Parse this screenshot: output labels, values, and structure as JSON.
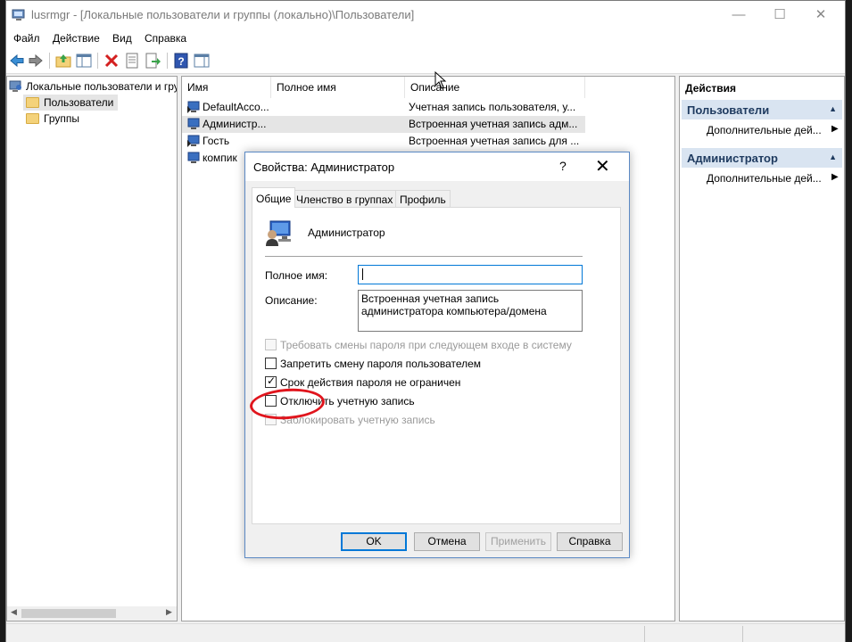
{
  "window": {
    "title": "lusrmgr - [Локальные пользователи и группы (локально)\\Пользователи]",
    "minimize": "—",
    "maximize": "☐",
    "close": "✕"
  },
  "menu": [
    "Файл",
    "Действие",
    "Вид",
    "Справка"
  ],
  "toolbar": {
    "buttons": [
      "back-icon",
      "forward-icon",
      "up-folder-icon",
      "show-hide-tree-icon",
      "delete-icon",
      "properties-icon",
      "export-icon",
      "help-icon",
      "show-action-pane-icon"
    ]
  },
  "tree": {
    "root": "Локальные пользователи и гру",
    "items": [
      "Пользователи",
      "Группы"
    ],
    "scroll_left": "◀",
    "scroll_right": "▶"
  },
  "list": {
    "columns": [
      "Имя",
      "Полное имя",
      "Описание"
    ],
    "rows": [
      {
        "name": "DefaultAcco...",
        "fullname": "",
        "description": "Учетная запись пользователя, у..."
      },
      {
        "name": "Администр...",
        "fullname": "",
        "description": "Встроенная учетная запись адм..."
      },
      {
        "name": "Гость",
        "fullname": "",
        "description": "Встроенная учетная запись для ..."
      },
      {
        "name": "компик",
        "fullname": "",
        "description": ""
      }
    ]
  },
  "actions": {
    "header": "Действия",
    "sections": [
      {
        "title": "Пользователи",
        "caret": "▲",
        "item": "Дополнительные дей...",
        "arrow": "▶"
      },
      {
        "title": "Администратор",
        "caret": "▲",
        "item": "Дополнительные дей...",
        "arrow": "▶"
      }
    ]
  },
  "dialog": {
    "title": "Свойства: Администратор",
    "help": "?",
    "close": "✕",
    "tabs": [
      "Общие",
      "Членство в группах",
      "Профиль"
    ],
    "user_name": "Администратор",
    "fullname_label": "Полное имя:",
    "fullname_value": "",
    "description_label": "Описание:",
    "description_value": "Встроенная учетная запись администратора компьютера/домена",
    "checkboxes": [
      {
        "label": "Требовать смены пароля при следующем входе в систему",
        "checked": false,
        "disabled": true
      },
      {
        "label": "Запретить смену пароля пользователем",
        "checked": false,
        "disabled": false
      },
      {
        "label": "Срок действия пароля не ограничен",
        "checked": true,
        "disabled": false
      },
      {
        "label": "Отключить учетную запись",
        "checked": false,
        "disabled": false
      },
      {
        "label": "Заблокировать учетную запись",
        "checked": false,
        "disabled": true
      }
    ],
    "check_mark": "✓",
    "buttons": {
      "ok": "OK",
      "cancel": "Отмена",
      "apply": "Применить",
      "help": "Справка"
    }
  },
  "colors": {
    "accent": "#0078d7",
    "highlight_circle": "#e0151d",
    "action_section_bg": "#d9e4f1"
  }
}
